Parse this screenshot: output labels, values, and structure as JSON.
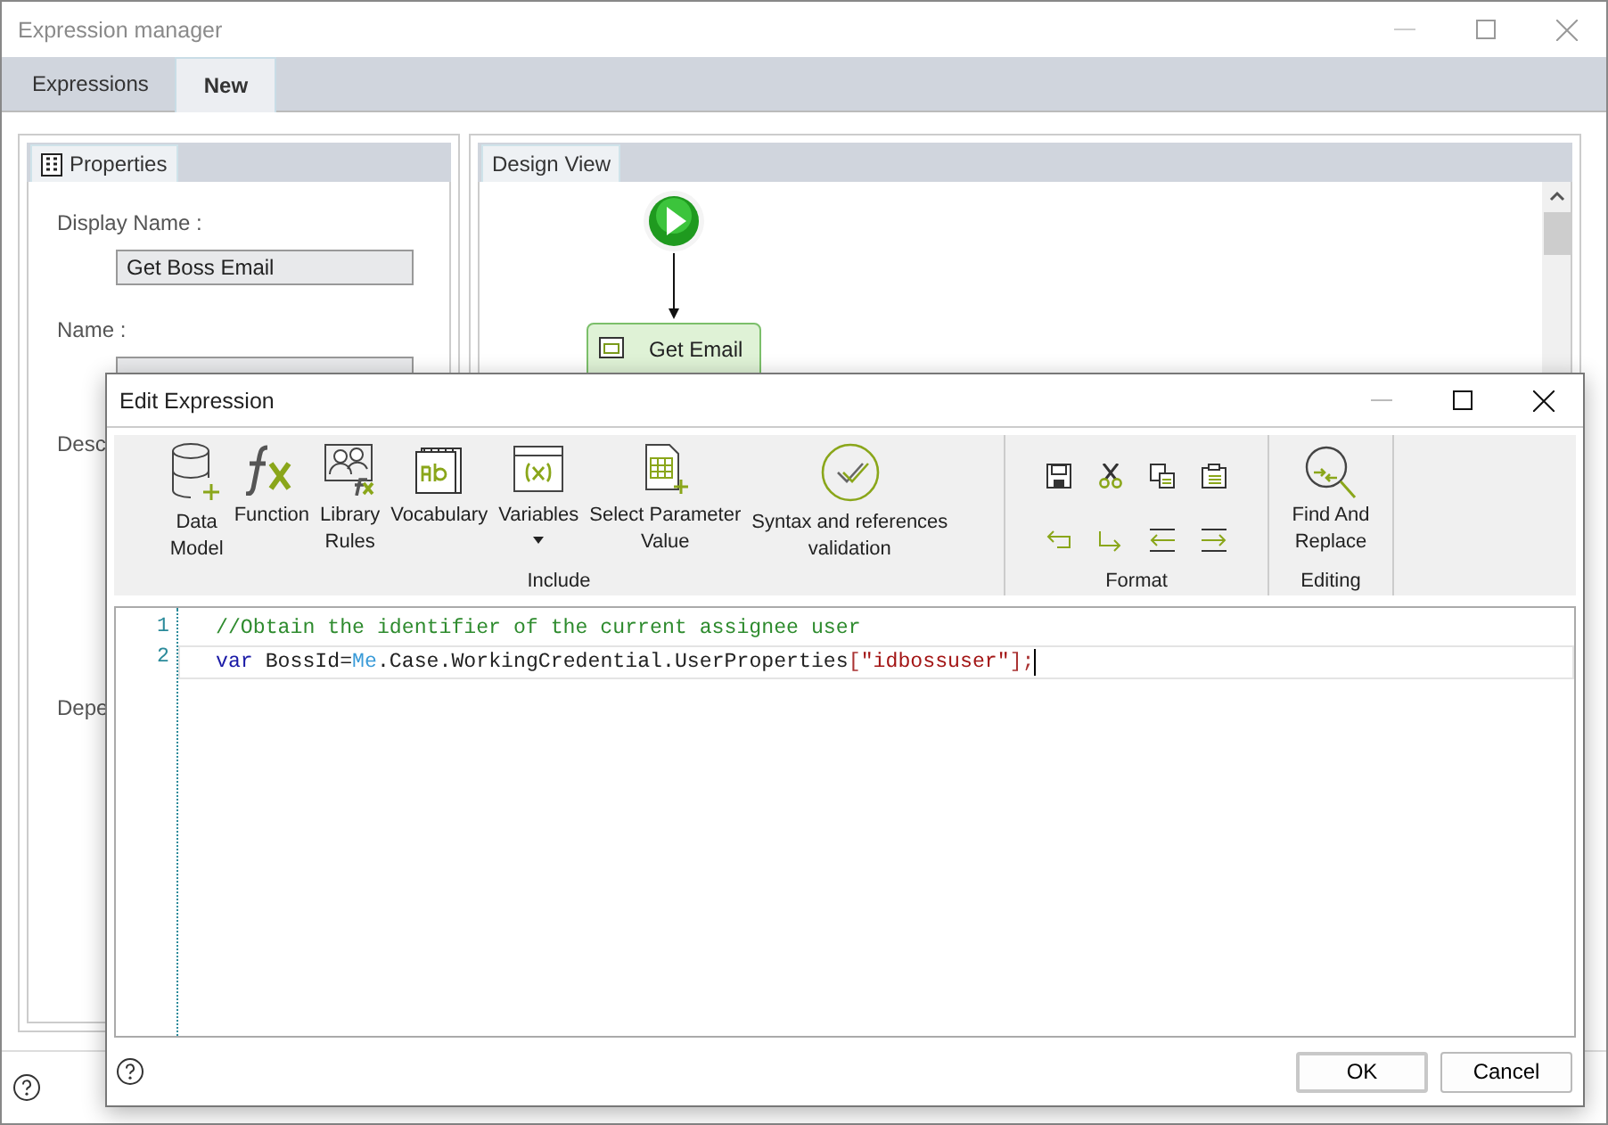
{
  "window": {
    "title": "Expression manager"
  },
  "tabs": [
    {
      "label": "Expressions",
      "selected": false
    },
    {
      "label": "New",
      "selected": true
    }
  ],
  "properties_panel": {
    "tab": "Properties",
    "fields": [
      {
        "label": "Display Name :",
        "value": "Get Boss Email"
      },
      {
        "label": "Name :"
      }
    ],
    "cut_labels": [
      "Desc",
      "Depe"
    ]
  },
  "design_view": {
    "tab": "Design View",
    "task_label": "Get Email"
  },
  "dialog": {
    "title": "Edit Expression",
    "include_group": {
      "label": "Include",
      "buttons": [
        {
          "kind": "data-model",
          "lines": [
            "Data",
            "Model"
          ]
        },
        {
          "kind": "function",
          "lines": [
            "Function"
          ]
        },
        {
          "kind": "library",
          "lines": [
            "Library",
            "Rules"
          ]
        },
        {
          "kind": "vocabulary",
          "lines": [
            "Vocabulary"
          ]
        },
        {
          "kind": "variables",
          "lines": [
            "Variables"
          ],
          "dropdown": true
        },
        {
          "kind": "parameter",
          "lines": [
            "Select Parameter",
            "Value"
          ]
        },
        {
          "kind": "validation",
          "lines": [
            "Syntax and references",
            "validation"
          ]
        }
      ]
    },
    "format_group": {
      "label": "Format"
    },
    "editing_group": {
      "label": "Editing",
      "button": [
        "Find And",
        "Replace"
      ]
    },
    "code_lines": [
      {
        "number": "1",
        "current": false,
        "tokens": [
          {
            "kind": "comment",
            "text": "//Obtain the identifier of the current assignee user"
          }
        ]
      },
      {
        "number": "2",
        "current": true,
        "tokens": [
          {
            "kind": "keyword",
            "text": "var"
          },
          {
            "kind": "plain",
            "text": " BossId="
          },
          {
            "kind": "object",
            "text": "Me"
          },
          {
            "kind": "plain",
            "text": ".Case.WorkingCredential.UserProperties"
          },
          {
            "kind": "punct",
            "text": "["
          },
          {
            "kind": "string",
            "text": "\"idbossuser\""
          },
          {
            "kind": "punct",
            "text": "];"
          }
        ]
      }
    ],
    "buttons": [
      "OK",
      "Cancel"
    ]
  }
}
